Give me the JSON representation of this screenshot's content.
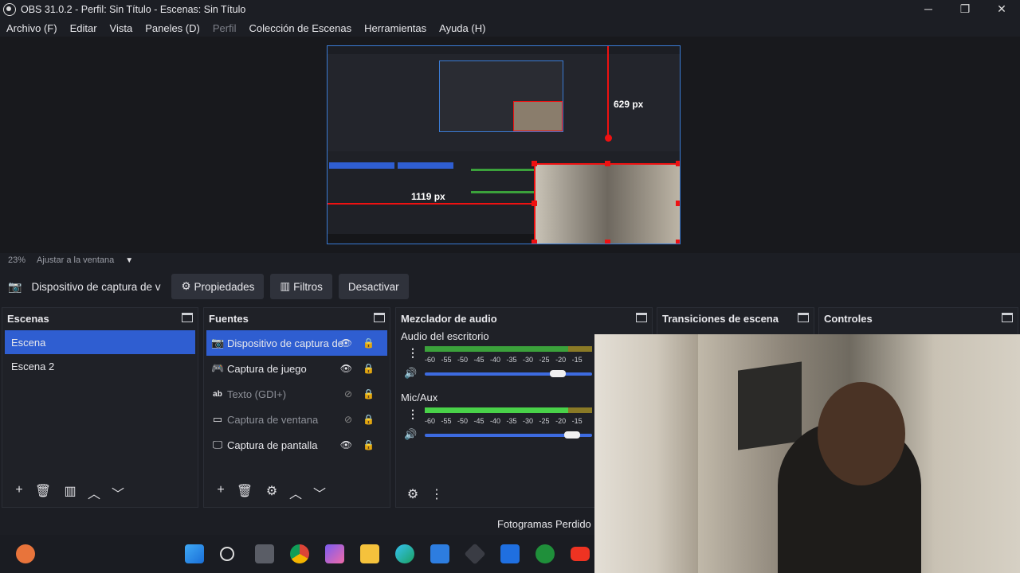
{
  "window": {
    "title": "OBS 31.0.2 - Perfil: Sin Título - Escenas: Sin Título",
    "controls": [
      "─",
      "❐",
      "✕"
    ]
  },
  "menu": {
    "items": [
      {
        "label": "Archivo (F)",
        "enabled": true
      },
      {
        "label": "Editar",
        "enabled": true
      },
      {
        "label": "Vista",
        "enabled": true
      },
      {
        "label": "Paneles (D)",
        "enabled": true
      },
      {
        "label": "Perfil",
        "enabled": false
      },
      {
        "label": "Colección de Escenas",
        "enabled": true
      },
      {
        "label": "Herramientas",
        "enabled": true
      },
      {
        "label": "Ayuda (H)",
        "enabled": true
      }
    ]
  },
  "preview": {
    "height_label": "629 px",
    "width_label": "1119 px"
  },
  "zoom": {
    "value": "23%",
    "mode": "Ajustar a la ventana"
  },
  "source_toolbar": {
    "source_name": "Dispositivo de captura de v",
    "properties": "Propiedades",
    "filters": "Filtros",
    "deactivate": "Desactivar"
  },
  "scenes": {
    "title": "Escenas",
    "items": [
      {
        "label": "Escena",
        "selected": true
      },
      {
        "label": "Escena 2",
        "selected": false
      }
    ]
  },
  "sources": {
    "title": "Fuentes",
    "items": [
      {
        "label": "Dispositivo de captura de",
        "icon": "camera-icon",
        "visible": true,
        "selected": true
      },
      {
        "label": "Captura de juego",
        "icon": "gamepad-icon",
        "visible": true,
        "selected": false
      },
      {
        "label": "Texto (GDI+)",
        "icon": "text-icon",
        "visible": false,
        "selected": false
      },
      {
        "label": "Captura de ventana",
        "icon": "window-icon",
        "visible": false,
        "selected": false
      },
      {
        "label": "Captura de pantalla",
        "icon": "monitor-icon",
        "visible": true,
        "selected": false
      }
    ]
  },
  "mixer": {
    "title": "Mezclador de audio",
    "scale": "-60 -55 -50 -45 -40 -35 -30 -25 -20 -15",
    "channels": [
      {
        "name": "Audio del escritorio",
        "level": 0,
        "fader": 0.78
      },
      {
        "name": "Mic/Aux",
        "level": 0.9,
        "fader": 0.87
      }
    ]
  },
  "transitions": {
    "title": "Transiciones de escena"
  },
  "controls": {
    "title": "Controles"
  },
  "status": {
    "frames_lost": "Fotogramas Perdido"
  },
  "colors": {
    "accent": "#2f5ed1",
    "selection_red": "#ee1111",
    "preview_border": "#3a7bd5"
  }
}
